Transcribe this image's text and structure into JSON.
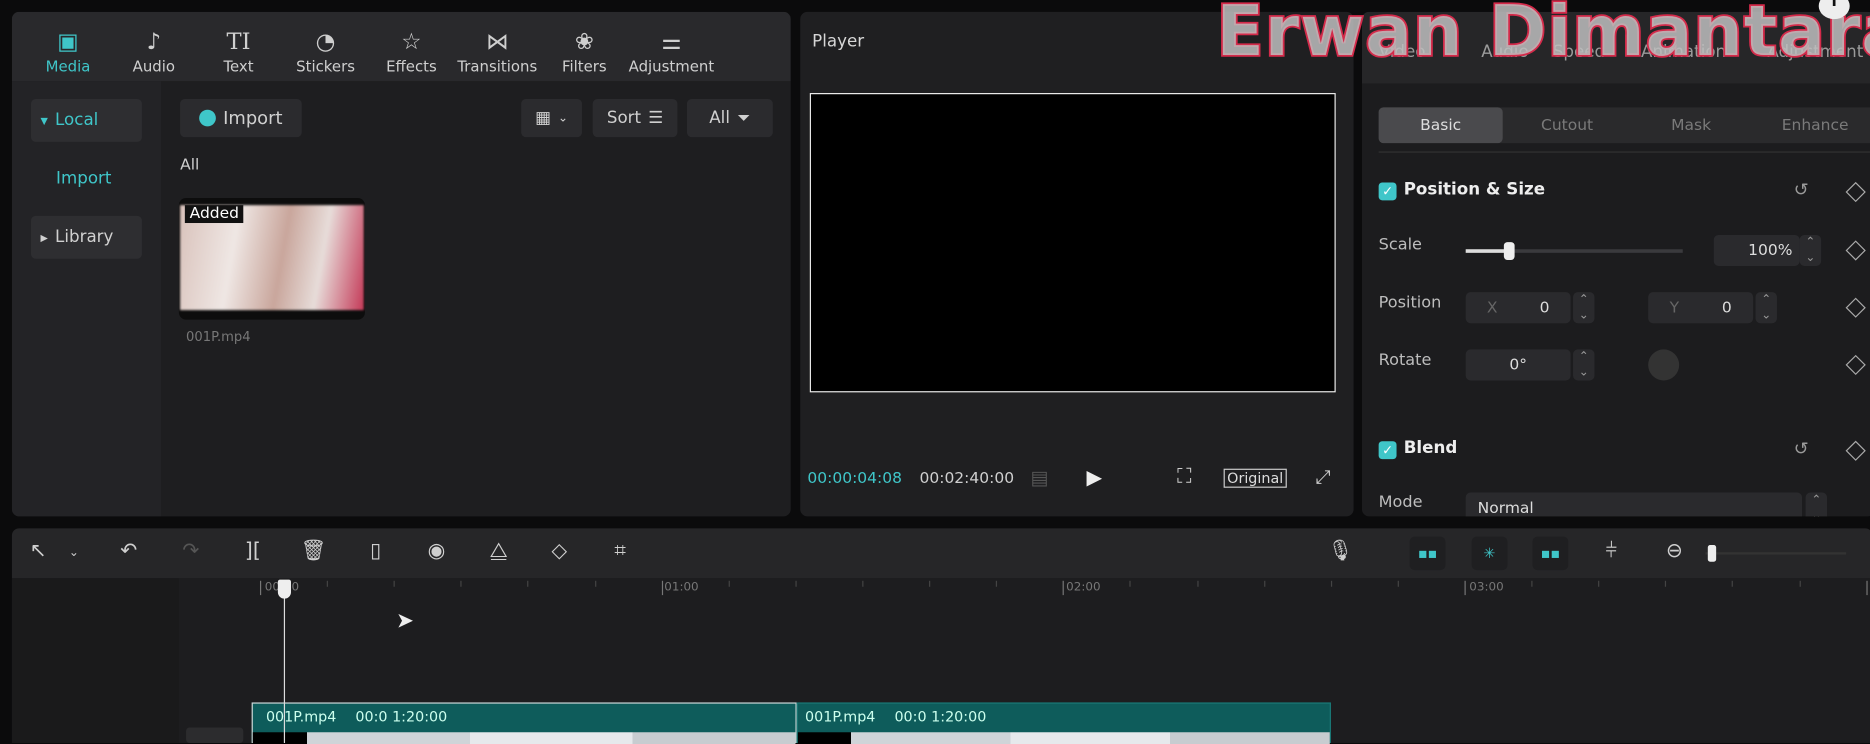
{
  "watermark": "Erwan Dimantara",
  "media_panel": {
    "toolbar": [
      {
        "label": "Media",
        "icon": "media-icon",
        "active": true
      },
      {
        "label": "Audio",
        "icon": "audio-icon"
      },
      {
        "label": "Text",
        "icon": "text-icon"
      },
      {
        "label": "Stickers",
        "icon": "stickers-icon"
      },
      {
        "label": "Effects",
        "icon": "effects-icon"
      },
      {
        "label": "Transitions",
        "icon": "transitions-icon"
      },
      {
        "label": "Filters",
        "icon": "filters-icon"
      },
      {
        "label": "Adjustment",
        "icon": "adjustment-icon"
      }
    ],
    "sidebar": {
      "local": "Local",
      "import": "Import",
      "library": "Library"
    },
    "import_button": "Import",
    "sort_label": "Sort",
    "filter_label": "All",
    "section_label": "All",
    "item": {
      "badge": "Added",
      "name": "001P.mp4"
    }
  },
  "player": {
    "title": "Player",
    "current_time": "00:00:04:08",
    "total_time": "00:02:40:00",
    "ratio_label": "Original"
  },
  "inspector": {
    "tabs": [
      "Video",
      "Audio",
      "Speed",
      "Animation",
      "Adjustment"
    ],
    "subtabs": [
      "Basic",
      "Cutout",
      "Mask",
      "Enhance"
    ],
    "position_size": "Position & Size",
    "scale_label": "Scale",
    "scale_value": "100%",
    "scale_fraction": 0.2,
    "position_label": "Position",
    "x_label": "X",
    "x_value": "0",
    "y_label": "Y",
    "y_value": "0",
    "rotate_label": "Rotate",
    "rotate_value": "0°",
    "blend": "Blend",
    "mode_label": "Mode",
    "mode_value": "Normal"
  },
  "timeline": {
    "ruler": [
      "00:00",
      "01:00",
      "02:00",
      "03:00"
    ],
    "clips": [
      {
        "name": "001P.mp4",
        "duration": "00:0 1:20:00"
      },
      {
        "name": "001P.mp4",
        "duration": "00:0 1:20:00"
      }
    ]
  },
  "colors": {
    "accent": "#3fc6c9",
    "clip": "#0e5c5b",
    "watermark": "#d42a4a"
  }
}
